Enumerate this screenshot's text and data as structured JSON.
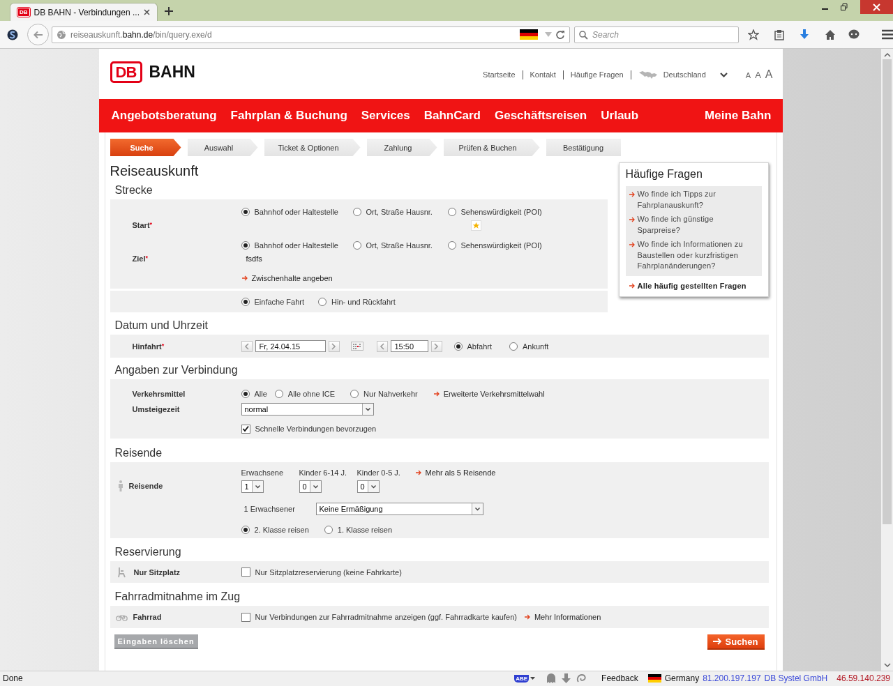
{
  "browser": {
    "favicon": "DB",
    "tab_title": "DB BAHN - Verbindungen ...",
    "url": "reiseauskunft.**bahn.de**/bin/query.exe/d",
    "search": {
      "placeholder": "Search"
    }
  },
  "header": {
    "logo": "DB",
    "brand": "BAHN",
    "links": [
      "Startseite",
      "Kontakt",
      "Häufige Fragen"
    ],
    "country": "Deutschland",
    "font_sizes": [
      "A",
      "A",
      "A"
    ]
  },
  "nav": {
    "items": [
      "Angebotsberatung",
      "Fahrplan & Buchung",
      "Services",
      "BahnCard",
      "Geschäftsreisen",
      "Urlaub"
    ],
    "account": "Meine Bahn"
  },
  "steps": [
    {
      "label": "Suche",
      "selected": true
    },
    {
      "label": "Auswahl",
      "selected": false
    },
    {
      "label": "Ticket & Optionen",
      "selected": false
    },
    {
      "label": "Zahlung",
      "selected": false
    },
    {
      "label": "Prüfen & Buchen",
      "selected": false
    },
    {
      "label": "Bestätigung",
      "selected": false
    }
  ],
  "page_title": "Reiseauskunft",
  "strecke": {
    "heading": "Strecke",
    "stops": [
      {
        "label": "Start",
        "required_mark": "*",
        "favorites": true,
        "options": [
          {
            "label": "Bahnhof oder Haltestelle",
            "selected": true
          },
          {
            "label": "Ort, Straße Hausnr.",
            "selected": false
          },
          {
            "label": "Sehenswürdigkeit (POI)",
            "selected": false
          }
        ]
      },
      {
        "label": "Ziel",
        "required_mark": "*",
        "value": "fsdfs",
        "options": [
          {
            "label": "Bahnhof oder Haltestelle",
            "selected": true
          },
          {
            "label": "Ort, Straße Hausnr.",
            "selected": false
          },
          {
            "label": "Sehenswürdigkeit (POI)",
            "selected": false
          }
        ]
      }
    ],
    "via_link": "Zwischenhalte angeben",
    "trip_types": [
      {
        "label": "Einfache Fahrt",
        "selected": true
      },
      {
        "label": "Hin- und Rückfahrt",
        "selected": false
      }
    ]
  },
  "datum": {
    "heading": "Datum und Uhrzeit",
    "label": "Hinfahrt",
    "required_mark": "*",
    "date": "Fr, 24.04.15",
    "time": "15:50",
    "modes": [
      {
        "label": "Abfahrt",
        "selected": true
      },
      {
        "label": "Ankunft",
        "selected": false
      }
    ]
  },
  "verbindung": {
    "heading": "Angaben zur Verbindung",
    "transport_label": "Verkehrsmittel",
    "transport_options": [
      {
        "label": "Alle",
        "selected": true
      },
      {
        "label": "Alle ohne ICE",
        "selected": false
      },
      {
        "label": "Nur Nahverkehr",
        "selected": false
      }
    ],
    "transport_link": "Erweiterte Verkehrsmittelwahl",
    "transfer_label": "Umsteigezeit",
    "transfer_value": "normal",
    "fast": {
      "label": "Schnelle Verbindungen bevorzugen",
      "checked": true
    }
  },
  "reisende": {
    "heading": "Reisende",
    "label": "Reisende",
    "counts": [
      {
        "label": "Erwachsene",
        "value": "1"
      },
      {
        "label": "Kinder 6-14 J.",
        "value": "0"
      },
      {
        "label": "Kinder 0-5 J.",
        "value": "0"
      }
    ],
    "more_link": "Mehr als 5 Reisende",
    "discount_label": "1 Erwachsener",
    "discount_value": "Keine Ermäßigung",
    "classes": [
      {
        "label": "2. Klasse reisen",
        "selected": true
      },
      {
        "label": "1. Klasse reisen",
        "selected": false
      }
    ]
  },
  "reservierung": {
    "heading": "Reservierung",
    "label": "Nur Sitzplatz",
    "option": {
      "label": "Nur Sitzplatzreservierung (keine Fahrkarte)",
      "checked": false
    }
  },
  "fahrrad": {
    "heading": "Fahrradmitnahme im Zug",
    "label": "Fahrrad",
    "option": {
      "label": "Nur Verbindungen zur Fahrradmitnahme anzeigen (ggf. Fahrradkarte kaufen)",
      "checked": false
    },
    "link": "Mehr Informationen"
  },
  "actions": {
    "reset": "Eingaben löschen",
    "submit": "Suchen"
  },
  "faq": {
    "title": "Häufige Fragen",
    "items": [
      "Wo finde ich Tipps zur Fahrplanauskunft?",
      "Wo finde ich günstige Sparpreise?",
      "Wo finde ich Informationen zu Baustellen oder kurzfristigen Fahrplanänderungen?"
    ],
    "all_link": "Alle häufig gestellten Fragen"
  },
  "status_bar": {
    "status": "Done",
    "addon_badge": "ABE",
    "feedback": "Feedback",
    "country": "Germany",
    "server_ip": "81.200.197.197",
    "organization": "DB Systel GmbH",
    "client_ip": "46.59.140.239"
  }
}
